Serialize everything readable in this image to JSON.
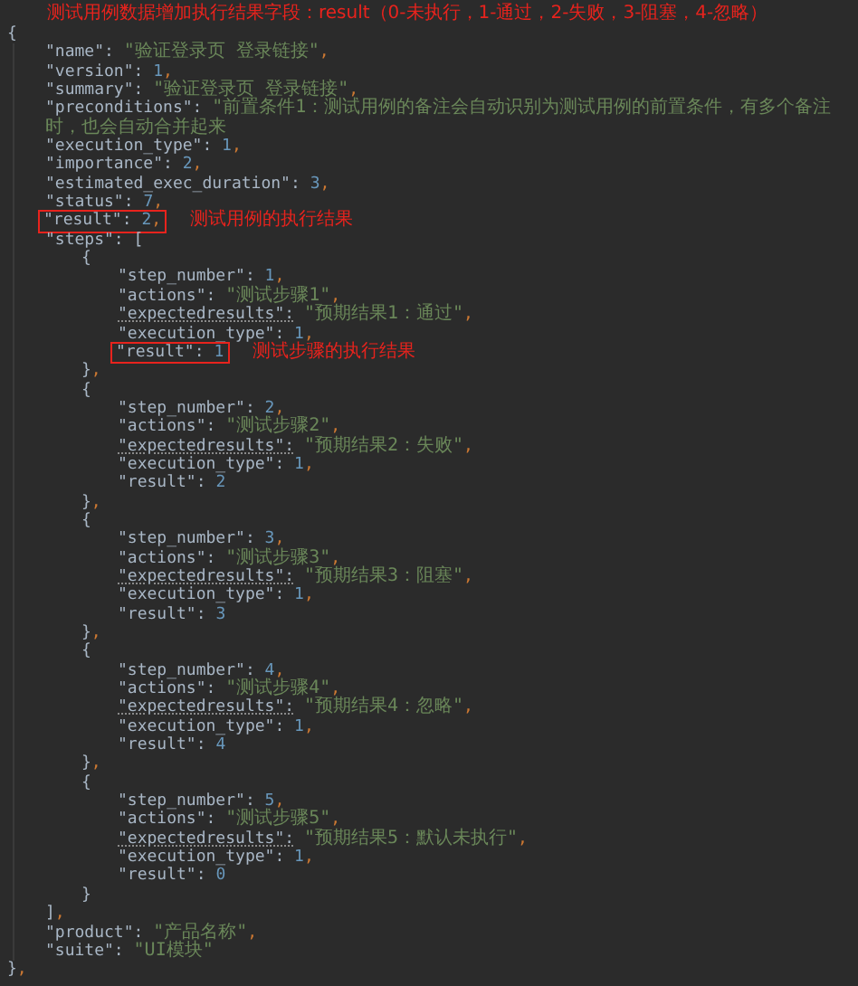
{
  "heading": "测试用例数据增加执行结果字段：result（0-未执行，1-通过，2-失败，3-阻塞，4-忽略）",
  "code": {
    "kind": "block",
    "open": "{",
    "close": "},",
    "children": [
      {
        "kind": "string",
        "key": "\"name\":",
        "value": "\"验证登录页 登录链接\"",
        "comma": ",",
        "flagged": false,
        "highlighted": false
      },
      {
        "kind": "number",
        "key": "\"version\":",
        "value": "1",
        "comma": ",",
        "flagged": false,
        "highlighted": false
      },
      {
        "kind": "string",
        "key": "\"summary\":",
        "value": "\"验证登录页 登录链接\"",
        "comma": ",",
        "flagged": false,
        "highlighted": false
      },
      {
        "kind": "string",
        "key": "\"preconditions\":",
        "value": "\"前置条件1：测试用例的备注会自动识别为测试用例的前置条件，有多个备注时，也会自动合并起来",
        "flagged": false,
        "highlighted": false
      },
      {
        "kind": "number",
        "key": "\"execution_type\":",
        "value": "1",
        "comma": ",",
        "flagged": false,
        "highlighted": false
      },
      {
        "kind": "number",
        "key": "\"importance\":",
        "value": "2",
        "comma": ",",
        "flagged": false,
        "highlighted": false
      },
      {
        "kind": "number",
        "key": "\"estimated_exec_duration\":",
        "value": "3",
        "comma": ",",
        "flagged": false,
        "highlighted": false
      },
      {
        "kind": "number",
        "key": "\"status\":",
        "value": "7",
        "comma": ",",
        "flagged": false,
        "highlighted": false
      },
      {
        "kind": "number",
        "key": "\"result\":",
        "value": "2",
        "comma": ",",
        "flagged": false,
        "highlighted": true,
        "note": "测试用例的执行结果"
      },
      {
        "kind": "list",
        "key": "\"steps\":",
        "open": "[",
        "close": "],",
        "children": [
          {
            "kind": "block",
            "open": "{",
            "close": "},",
            "children": [
              {
                "kind": "number",
                "key": "\"step_number\":",
                "value": "1",
                "comma": ",",
                "flagged": false,
                "highlighted": false
              },
              {
                "kind": "string",
                "key": "\"actions\":",
                "value": "\"测试步骤1\"",
                "comma": ",",
                "flagged": false,
                "highlighted": false
              },
              {
                "kind": "string",
                "key": "\"expectedresults\":",
                "value": "\"预期结果1：通过\"",
                "comma": ",",
                "flagged": true,
                "highlighted": false
              },
              {
                "kind": "number",
                "key": "\"execution_type\":",
                "value": "1",
                "comma": ",",
                "flagged": false,
                "highlighted": false
              },
              {
                "kind": "number",
                "key": "\"result\":",
                "value": "1",
                "flagged": false,
                "highlighted": true,
                "note": "测试步骤的执行结果"
              }
            ]
          },
          {
            "kind": "block",
            "open": "{",
            "close": "},",
            "children": [
              {
                "kind": "number",
                "key": "\"step_number\":",
                "value": "2",
                "comma": ",",
                "flagged": false,
                "highlighted": false
              },
              {
                "kind": "string",
                "key": "\"actions\":",
                "value": "\"测试步骤2\"",
                "comma": ",",
                "flagged": false,
                "highlighted": false
              },
              {
                "kind": "string",
                "key": "\"expectedresults\":",
                "value": "\"预期结果2：失败\"",
                "comma": ",",
                "flagged": true,
                "highlighted": false
              },
              {
                "kind": "number",
                "key": "\"execution_type\":",
                "value": "1",
                "comma": ",",
                "flagged": false,
                "highlighted": false
              },
              {
                "kind": "number",
                "key": "\"result\":",
                "value": "2",
                "flagged": false,
                "highlighted": false
              }
            ]
          },
          {
            "kind": "block",
            "open": "{",
            "close": "},",
            "children": [
              {
                "kind": "number",
                "key": "\"step_number\":",
                "value": "3",
                "comma": ",",
                "flagged": false,
                "highlighted": false
              },
              {
                "kind": "string",
                "key": "\"actions\":",
                "value": "\"测试步骤3\"",
                "comma": ",",
                "flagged": false,
                "highlighted": false
              },
              {
                "kind": "string",
                "key": "\"expectedresults\":",
                "value": "\"预期结果3：阻塞\"",
                "comma": ",",
                "flagged": true,
                "highlighted": false
              },
              {
                "kind": "number",
                "key": "\"execution_type\":",
                "value": "1",
                "comma": ",",
                "flagged": false,
                "highlighted": false
              },
              {
                "kind": "number",
                "key": "\"result\":",
                "value": "3",
                "flagged": false,
                "highlighted": false
              }
            ]
          },
          {
            "kind": "block",
            "open": "{",
            "close": "},",
            "children": [
              {
                "kind": "number",
                "key": "\"step_number\":",
                "value": "4",
                "comma": ",",
                "flagged": false,
                "highlighted": false
              },
              {
                "kind": "string",
                "key": "\"actions\":",
                "value": "\"测试步骤4\"",
                "comma": ",",
                "flagged": false,
                "highlighted": false
              },
              {
                "kind": "string",
                "key": "\"expectedresults\":",
                "value": "\"预期结果4：忽略\"",
                "comma": ",",
                "flagged": true,
                "highlighted": false
              },
              {
                "kind": "number",
                "key": "\"execution_type\":",
                "value": "1",
                "comma": ",",
                "flagged": false,
                "highlighted": false
              },
              {
                "kind": "number",
                "key": "\"result\":",
                "value": "4",
                "flagged": false,
                "highlighted": false
              }
            ]
          },
          {
            "kind": "block",
            "open": "{",
            "close": "}",
            "children": [
              {
                "kind": "number",
                "key": "\"step_number\":",
                "value": "5",
                "comma": ",",
                "flagged": false,
                "highlighted": false
              },
              {
                "kind": "string",
                "key": "\"actions\":",
                "value": "\"测试步骤5\"",
                "comma": ",",
                "flagged": false,
                "highlighted": false
              },
              {
                "kind": "string",
                "key": "\"expectedresults\":",
                "value": "\"预期结果5：默认未执行\"",
                "comma": ",",
                "flagged": true,
                "highlighted": false
              },
              {
                "kind": "number",
                "key": "\"execution_type\":",
                "value": "1",
                "comma": ",",
                "flagged": false,
                "highlighted": false
              },
              {
                "kind": "number",
                "key": "\"result\":",
                "value": "0",
                "flagged": false,
                "highlighted": false
              }
            ]
          }
        ]
      },
      {
        "kind": "string",
        "key": "\"product\":",
        "value": "\"产品名称\"",
        "comma": ",",
        "flagged": false,
        "highlighted": false
      },
      {
        "kind": "string",
        "key": "\"suite\":",
        "value": "\"UI模块\"",
        "flagged": false,
        "highlighted": false
      }
    ]
  }
}
